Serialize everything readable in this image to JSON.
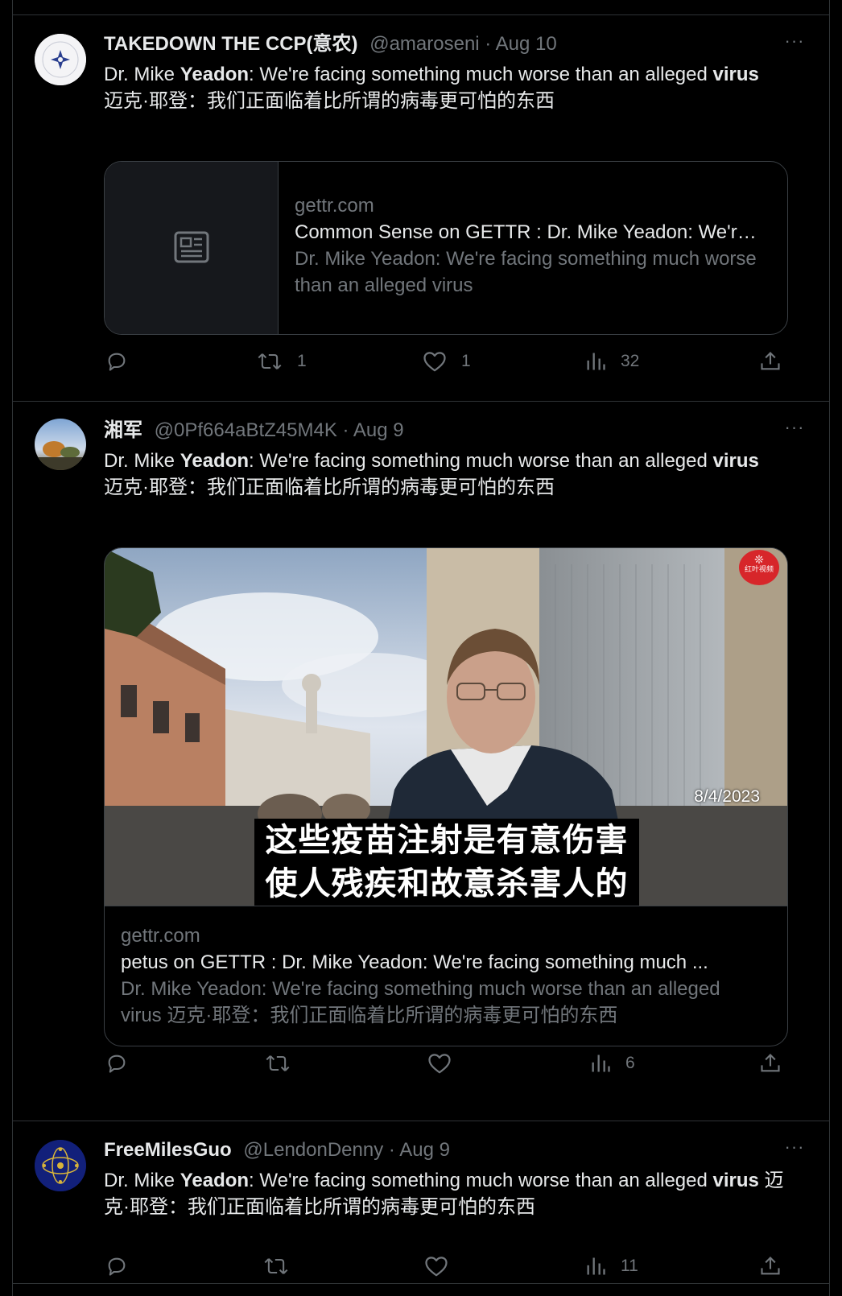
{
  "tweets": [
    {
      "display_name": "TAKEDOWN THE CCP(意农)",
      "handle": "@amaroseni",
      "date": "Aug 10",
      "more": "···",
      "text_prefix": "Dr. Mike ",
      "text_bold1": "Yeadon",
      "text_mid": ": We're facing something much worse than an alleged ",
      "text_bold2": "virus",
      "text_chinese": "迈克·耶登：我们正面临着比所谓的病毒更可怕的东西",
      "card": {
        "domain": "gettr.com",
        "title": "Common Sense on GETTR : Dr. Mike Yeadon: We're facing something much worse than an alleged virus",
        "description": "Dr. Mike Yeadon: We're facing something much worse than an alleged virus"
      },
      "actions": {
        "reply": "",
        "repost": "1",
        "like": "1",
        "views": "32"
      }
    },
    {
      "display_name": "湘军",
      "handle": "@0Pf664aBtZ45M4K",
      "date": "Aug 9",
      "more": "···",
      "text_prefix": "Dr. Mike ",
      "text_bold1": "Yeadon",
      "text_mid": ": We're facing something much worse than an alleged ",
      "text_bold2": "virus",
      "text_chinese": "迈克·耶登：我们正面临着比所谓的病毒更可怕的东西",
      "video": {
        "date_overlay": "8/4/2023",
        "subtitle_line1": "这些疫苗注射是有意伤害",
        "subtitle_line2": "使人残疾和故意杀害人的",
        "logo_text": "红叶视频"
      },
      "card": {
        "domain": "gettr.com",
        "title": "petus on GETTR : Dr. Mike Yeadon: We're facing something much ...",
        "description": "Dr. Mike Yeadon: We're facing something much worse than an alleged virus 迈克·耶登：我们正面临着比所谓的病毒更可怕的东西"
      },
      "actions": {
        "reply": "",
        "repost": "",
        "like": "",
        "views": "6"
      }
    },
    {
      "display_name": "FreeMilesGuo",
      "handle": "@LendonDenny",
      "date": "Aug 9",
      "more": "···",
      "text_prefix": "Dr. Mike ",
      "text_bold1": "Yeadon",
      "text_mid": ": We're facing something much worse than an alleged ",
      "text_bold2": "virus",
      "text_chinese": " 迈克·耶登：我们正面临着比所谓的病毒更可怕的东西",
      "actions": {
        "reply": "",
        "repost": "",
        "like": "",
        "views": "11"
      }
    }
  ],
  "separator": " · ",
  "colors": {
    "background": "#000000",
    "text": "#e7e9ea",
    "secondary": "#71767b",
    "border": "#2f3336"
  },
  "icons": [
    "reply-icon",
    "repost-icon",
    "like-icon",
    "views-icon",
    "share-icon",
    "article-icon",
    "more-icon"
  ]
}
